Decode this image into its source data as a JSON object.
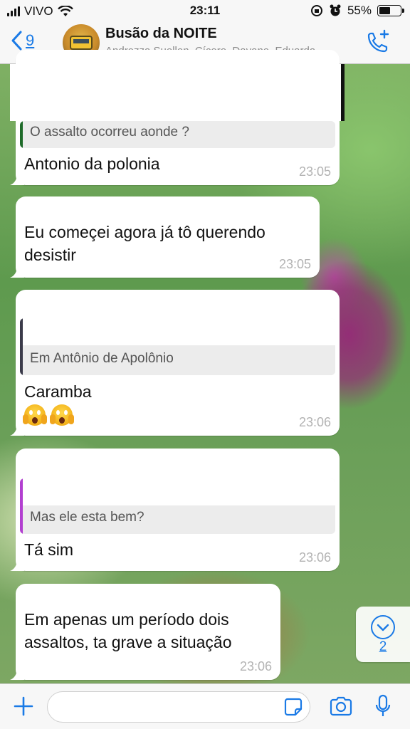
{
  "status_bar": {
    "carrier": "VIVO",
    "time": "23:11",
    "battery": "55%",
    "battery_level": 0.55
  },
  "header": {
    "back_count": "9",
    "title": "Busão da NOITE",
    "subtitle": "Andrezza Suellen, Cícero, Dayane, Eduarda..."
  },
  "messages": [
    {
      "text": "Antonio da polonia",
      "time": "23:05",
      "quote": "O assalto ocorreu aonde ?",
      "quote_color": "#1f6b2a"
    },
    {
      "text": "Eu começei agora já tô querendo desistir",
      "time": "23:05"
    },
    {
      "text": "Caramba",
      "time": "23:06",
      "quote": "Em Antônio de Apolônio",
      "quote_color": "#3b3b4a",
      "emoji": [
        "face-screaming-in-fear",
        "face-screaming-in-fear"
      ]
    },
    {
      "text": "Tá sim",
      "time": "23:06",
      "quote": "Mas ele esta bem?",
      "quote_color": "#b23fd0"
    },
    {
      "text": "Em apenas um período dois assaltos, ta grave a situação",
      "time": "23:06"
    }
  ],
  "scroll_down": {
    "count": "2"
  },
  "input": {
    "value": "",
    "placeholder": ""
  },
  "colors": {
    "accent": "#1a7ae6",
    "bubble": "#ffffff",
    "header_bg": "#f7f7f7"
  }
}
